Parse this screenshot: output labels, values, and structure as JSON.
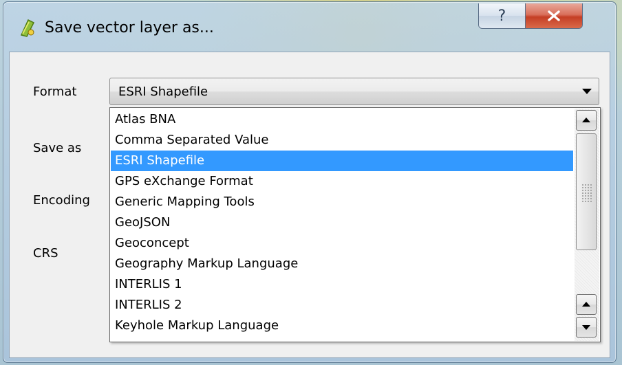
{
  "window": {
    "title": "Save vector layer as...",
    "help_label": "?",
    "colors": {
      "selection": "#3399ff",
      "close_button": "#c53f25"
    }
  },
  "form": {
    "format_label": "Format",
    "save_as_label": "Save as",
    "encoding_label": "Encoding",
    "crs_label": "CRS",
    "format_value": "ESRI Shapefile"
  },
  "dropdown": {
    "selected_index": 2,
    "options": [
      "Atlas BNA",
      "Comma Separated Value",
      "ESRI Shapefile",
      "GPS eXchange Format",
      "Generic Mapping Tools",
      "GeoJSON",
      "Geoconcept",
      "Geography Markup Language",
      "INTERLIS 1",
      "INTERLIS 2",
      "Keyhole Markup Language"
    ]
  }
}
